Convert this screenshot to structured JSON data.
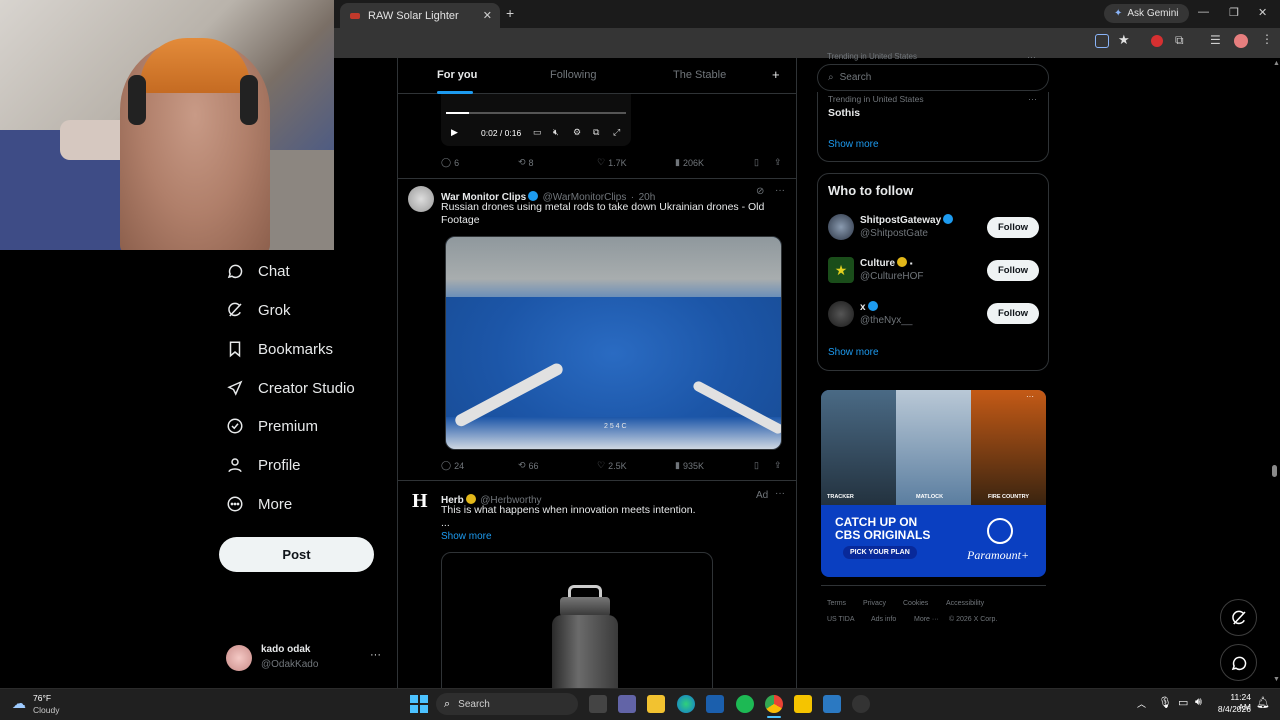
{
  "browser": {
    "tab_title": "RAW Solar Lighter",
    "ask_gemini": "Ask Gemini"
  },
  "nav": {
    "items": [
      {
        "label": "Chat",
        "icon": "chat-icon"
      },
      {
        "label": "Grok",
        "icon": "grok-icon"
      },
      {
        "label": "Bookmarks",
        "icon": "bookmark-icon"
      },
      {
        "label": "Creator Studio",
        "icon": "rocket-icon"
      },
      {
        "label": "Premium",
        "icon": "verified-icon"
      },
      {
        "label": "Profile",
        "icon": "person-icon"
      },
      {
        "label": "More",
        "icon": "more-circle-icon"
      }
    ],
    "post_label": "Post",
    "account_name": "kado odak",
    "account_handle": "@OdakKado",
    "account_more": "···"
  },
  "feed": {
    "tabs": [
      "For you",
      "Following",
      "The Stable"
    ],
    "add_tab": "+",
    "video_time": "0:02 / 0:16",
    "post1_stats": {
      "replies": "6",
      "reposts": "8",
      "likes": "1.7K",
      "views": "206K"
    },
    "post2": {
      "name": "War Monitor Clips",
      "handle": "@WarMonitorClips",
      "time": "20h",
      "text": "Russian drones using metal rods to take down Ukrainian drones - Old Footage",
      "overlay_number": "2 5 4 C",
      "stats": {
        "replies": "24",
        "reposts": "66",
        "likes": "2.5K",
        "views": "935K"
      }
    },
    "post3": {
      "name": "Herb",
      "handle": "@Herbworthy",
      "ad_label": "Ad",
      "text": "This is what happens when innovation meets intention.",
      "ellipsis": "...",
      "show_more": "Show more",
      "avatar_letter": "H"
    }
  },
  "right": {
    "search_placeholder": "Search",
    "trending_top": "Trending in United States",
    "trending_label": "Trending in United States",
    "trending_topic": "Sothis",
    "show_more": "Show more",
    "who_to_follow_title": "Who to follow",
    "follow_label": "Follow",
    "suggestions": [
      {
        "name": "ShitpostGateway",
        "handle": "@ShitpostGate"
      },
      {
        "name": "Culture",
        "handle": "@CultureHOF"
      },
      {
        "name": "x",
        "handle": "@theNyx__"
      }
    ],
    "ad": {
      "headline": "CATCH UP ON CBS ORIGINALS",
      "cta": "PICK YOUR PLAN",
      "brand": "Paramount+",
      "shows": [
        "TRACKER",
        "MATLOCK",
        "FIRE COUNTRY"
      ]
    },
    "footer_row1": [
      "Terms",
      "Privacy",
      "Cookies",
      "Accessibility"
    ],
    "footer_row2": [
      "US TIDA",
      "Ads info",
      "More ···",
      "© 2026 X Corp."
    ]
  },
  "taskbar": {
    "temperature": "76°F",
    "weather": "Cloudy",
    "search": "Search",
    "time": "11:24 AM",
    "date": "8/4/2026"
  }
}
